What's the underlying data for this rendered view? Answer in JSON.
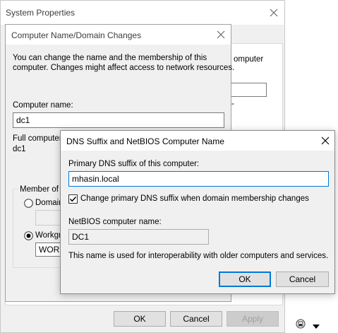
{
  "system_properties": {
    "title": "System Properties",
    "bg_text_right": "omputer",
    "bg_text_dash": "-",
    "ok_label": "OK",
    "cancel_label": "Cancel",
    "apply_label": "Apply"
  },
  "computer_name_dialog": {
    "title": "Computer Name/Domain Changes",
    "description_line1": "You can change the name and the membership of this",
    "description_line2": "computer. Changes might affect access to network resources.",
    "computer_name_label": "Computer name:",
    "computer_name_value": "dc1",
    "full_name_label": "Full computer n",
    "full_name_value": "dc1",
    "member_of_label": "Member of",
    "domain_label": "Domain",
    "workgroup_label": "Workgro",
    "workgroup_value": "WORK"
  },
  "dns_dialog": {
    "title": "DNS Suffix and NetBIOS Computer Name",
    "primary_dns_label": "Primary DNS suffix of this computer:",
    "primary_dns_value": "mhasin.local",
    "change_checkbox_label": "Change primary DNS suffix when domain membership changes",
    "change_checkbox_checked": true,
    "netbios_label": "NetBIOS computer name:",
    "netbios_value": "DC1",
    "info_text": "This name is used for interoperability with older computers and services.",
    "ok_label": "OK",
    "cancel_label": "Cancel"
  },
  "colors": {
    "accent": "#0078d7",
    "dialog_bg": "#f0f0f0",
    "button_bg": "#e1e1e1"
  }
}
